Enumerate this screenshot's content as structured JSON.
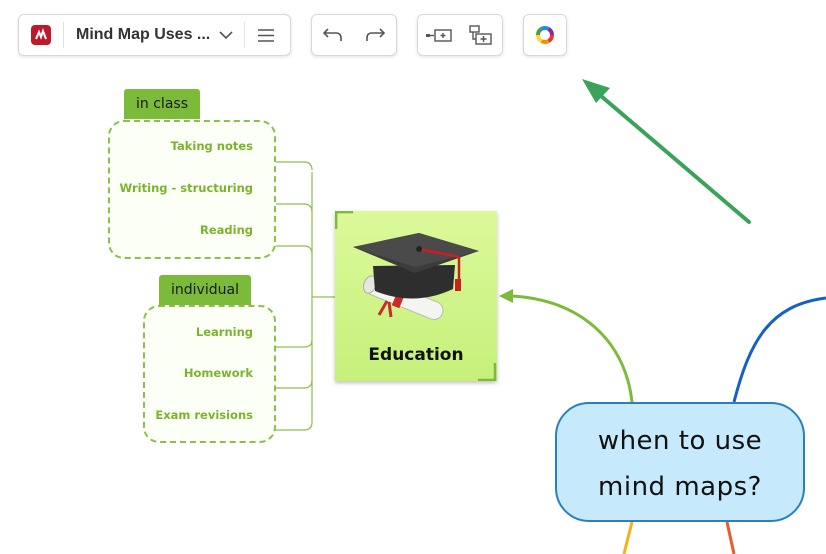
{
  "toolbar": {
    "document_title": "Mind Map Uses ...",
    "logo_icon": "mindmeister-logo-icon",
    "buttons": [
      {
        "name": "dropdown",
        "icon": "chevron-down-icon"
      },
      {
        "name": "menu",
        "icon": "hamburger-menu-icon"
      },
      {
        "name": "undo",
        "icon": "undo-arrow-icon"
      },
      {
        "name": "redo",
        "icon": "redo-arrow-icon"
      },
      {
        "name": "add-child",
        "icon": "add-child-topic-icon"
      },
      {
        "name": "add-sibling",
        "icon": "add-sibling-topic-icon"
      },
      {
        "name": "theme",
        "icon": "color-wheel-icon"
      }
    ]
  },
  "map": {
    "central_topic": {
      "line1": "when to use",
      "line2": "mind maps?",
      "fill": "#c6e9fb",
      "border": "#2a7fc1"
    },
    "main_topic": {
      "label": "Education",
      "fill": "#c6f07a",
      "image": "graduation-cap-diploma-image"
    },
    "groups": [
      {
        "label": "in class",
        "items": [
          "Taking notes",
          "Writing - structuring",
          "Reading"
        ]
      },
      {
        "label": "individual",
        "items": [
          "Learning",
          "Homework",
          "Exam revisions"
        ]
      }
    ],
    "colors": {
      "branch_green": "#7cba3a",
      "leaf_text": "#7cb32e",
      "annotation_arrow": "#3aa35a",
      "branch_blue": "#1560c8"
    }
  }
}
